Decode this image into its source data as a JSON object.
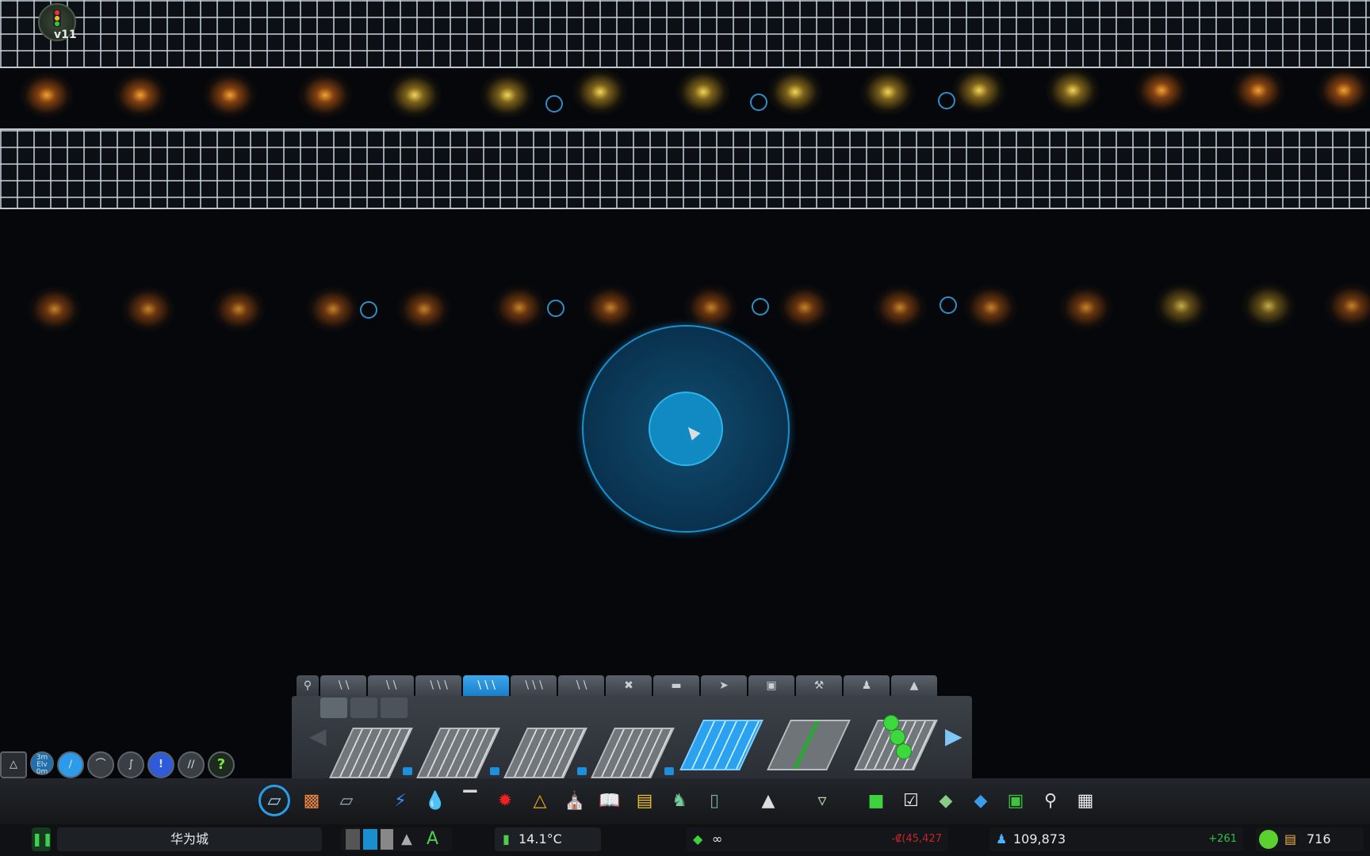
{
  "mod_badge": {
    "version": "v11",
    "icon": "traffic-light-icon"
  },
  "road_panel": {
    "search_icon": "search-icon",
    "tabs": [
      "small-roads",
      "medium-roads",
      "large-roads",
      "highways",
      "one-way",
      "tracks",
      "intersections",
      "bus-roads",
      "pedestrian",
      "parking",
      "tools",
      "paths",
      "vehicles"
    ],
    "active_tab_index": 4,
    "subtabs": [
      "road-surface",
      "green-road",
      "bus-road"
    ],
    "roads": [
      {
        "name": "four-lane-highway-icon",
        "checked": true
      },
      {
        "name": "three-lane-highway-icon",
        "checked": true
      },
      {
        "name": "two-lane-highway-icon",
        "checked": true
      },
      {
        "name": "one-lane-highway-icon",
        "checked": true
      },
      {
        "name": "blue-highway-icon",
        "checked": false
      },
      {
        "name": "green-median-highway-icon",
        "checked": false
      },
      {
        "name": "tree-highway-icon",
        "checked": false
      }
    ]
  },
  "left_tools": {
    "elevation_label": "3m Elv 0m",
    "help_label": "?"
  },
  "toolbar_icons": [
    "roads-icon",
    "zoning-icon",
    "districts-icon",
    "electricity-icon",
    "water-icon",
    "industry-icon",
    "fire-icon",
    "police-icon",
    "healthcare-icon",
    "education-icon",
    "public-transport-icon",
    "beautification-icon",
    "monuments-icon",
    "landscaping-icon",
    "terrain-icon",
    "unique-buildings-icon",
    "checklist-icon",
    "resources-icon",
    "areas-icon",
    "map-icon",
    "search-icon",
    "vehicles-icon"
  ],
  "status": {
    "city_name": "华为城",
    "temperature": "14.1°C",
    "money": "∞",
    "balance": "-₡(45,427",
    "population": "109,873",
    "population_delta": "+261",
    "happiness_value": "716"
  },
  "colors": {
    "accent": "#1a7fcc",
    "cursor": "#1189c2",
    "grid": "#bfc7cf",
    "light_orange": "#e69a32",
    "light_yellow": "#f2d15a"
  }
}
